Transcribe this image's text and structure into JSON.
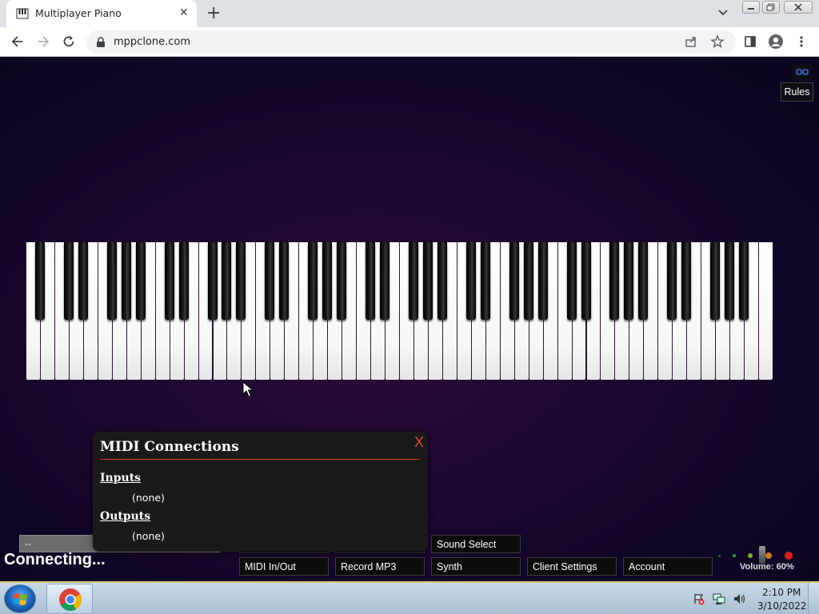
{
  "browser": {
    "tab_title": "Multiplayer Piano",
    "tab_close": "✕",
    "new_tab": "+",
    "url": "mppclone.com"
  },
  "page": {
    "rules_label": "Rules",
    "piano": {
      "white_key_count": 52,
      "black_key_count": 36
    },
    "midi_modal": {
      "title": "MIDI Connections",
      "close": "X",
      "inputs_label": "Inputs",
      "inputs_value": "(none)",
      "outputs_label": "Outputs",
      "outputs_value": "(none)"
    },
    "chat_input_value": "--",
    "status": "Connecting...",
    "controls": {
      "sound_select": "Sound Select",
      "midi_inout": "MIDI In/Out",
      "record_mp3": "Record MP3",
      "synth": "Synth",
      "client_settings": "Client Settings",
      "account": "Account"
    },
    "volume_label": "Volume: 60%",
    "volume_percent": 60
  },
  "taskbar": {
    "time": "2:10 PM",
    "date": "3/10/2022"
  },
  "colors": {
    "accent_red": "#d03a1e",
    "page_bg": "#1e0830"
  }
}
